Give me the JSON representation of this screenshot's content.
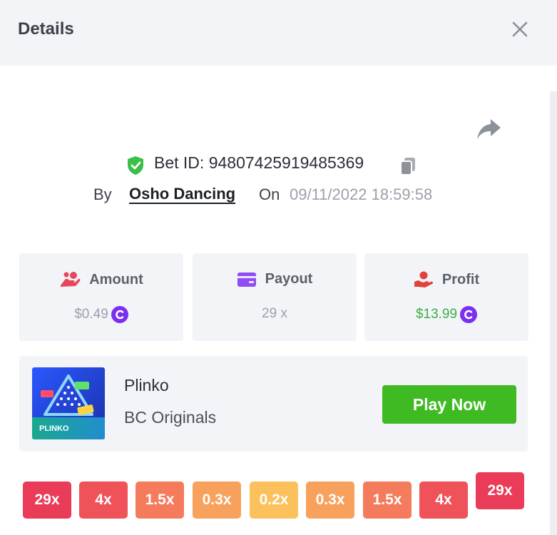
{
  "header": {
    "title": "Details"
  },
  "bet": {
    "id_label": "Bet ID: 94807425919485369",
    "by_label": "By",
    "user": "Osho Dancing",
    "on_label": "On",
    "datetime": "09/11/2022 18:59:58"
  },
  "stats": [
    {
      "label": "Amount",
      "value": "$0.49",
      "icon": "hand-coins-icon",
      "color": "#e8465d",
      "has_coin": true
    },
    {
      "label": "Payout",
      "value": "29 x",
      "icon": "card-icon",
      "color": "#8f4cf6",
      "has_coin": false
    },
    {
      "label": "Profit",
      "value": "$13.99",
      "icon": "profit-hand-icon",
      "color": "#e0433d",
      "has_coin": true
    }
  ],
  "game": {
    "name": "Plinko",
    "provider": "BC Originals",
    "thumb_label": "PLINKO",
    "play_label": "Play Now"
  },
  "multipliers": [
    {
      "label": "29x",
      "color": "#ea3b58"
    },
    {
      "label": "4x",
      "color": "#f0525a"
    },
    {
      "label": "1.5x",
      "color": "#f47b5c"
    },
    {
      "label": "0.3x",
      "color": "#f7a15c"
    },
    {
      "label": "0.2x",
      "color": "#fcc15c"
    },
    {
      "label": "0.3x",
      "color": "#f7a15c"
    },
    {
      "label": "1.5x",
      "color": "#f47b5c"
    },
    {
      "label": "4x",
      "color": "#f0525a"
    },
    {
      "label": "29x",
      "color": "#ea3b58",
      "active": true
    }
  ],
  "colors": {
    "accent_green": "#3fba23",
    "coin": "#7b2ff0",
    "shield": "#3bbf48"
  }
}
